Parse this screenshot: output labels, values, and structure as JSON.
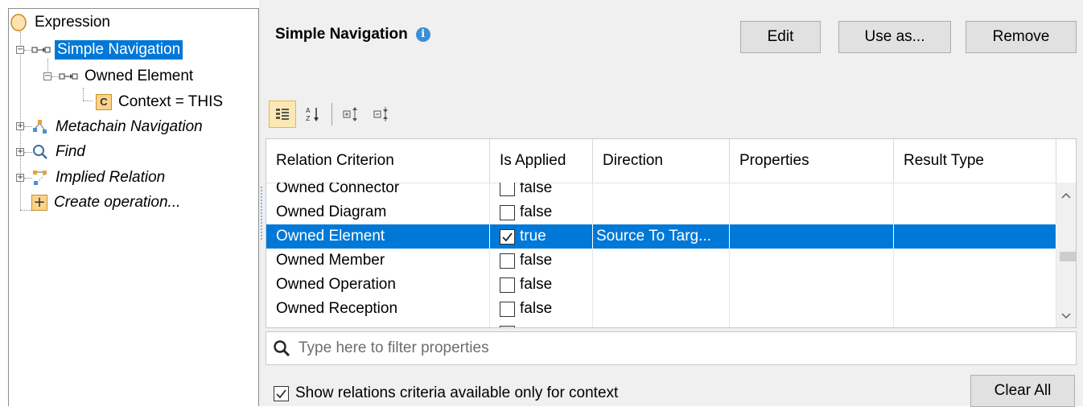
{
  "tree": {
    "items": [
      {
        "label": "Expression",
        "icon": "expression-icon"
      },
      {
        "label": "Simple Navigation",
        "icon": "navigation-icon",
        "selected": true
      },
      {
        "label": "Owned Element",
        "icon": "navigation-icon"
      },
      {
        "label": "Context = THIS",
        "icon": "context-icon",
        "icon_letter": "C"
      },
      {
        "label": "Metachain Navigation",
        "icon": "metachain-icon"
      },
      {
        "label": "Find",
        "icon": "search-icon"
      },
      {
        "label": "Implied Relation",
        "icon": "implied-relation-icon"
      },
      {
        "label": "Create operation...",
        "icon": "plus-icon"
      }
    ]
  },
  "header": {
    "title": "Simple Navigation",
    "info_icon": "info-icon",
    "buttons": {
      "edit": "Edit",
      "use_as": "Use as...",
      "remove": "Remove"
    }
  },
  "toolbar": {
    "icons": [
      "categorized-view-icon",
      "sort-alphabetically-icon",
      "expand-all-icon",
      "collapse-all-icon"
    ]
  },
  "table": {
    "columns": [
      "Relation Criterion",
      "Is Applied",
      "Direction",
      "Properties",
      "Result Type"
    ],
    "rows": [
      {
        "criterion": "Owned Connector",
        "applied": "false",
        "checked": false,
        "direction": "",
        "properties": "",
        "result_type": ""
      },
      {
        "criterion": "Owned Diagram",
        "applied": "false",
        "checked": false,
        "direction": "",
        "properties": "",
        "result_type": ""
      },
      {
        "criterion": "Owned Element",
        "applied": "true",
        "checked": true,
        "direction": "Source To Targ...",
        "properties": "",
        "result_type": "",
        "selected": true
      },
      {
        "criterion": "Owned Member",
        "applied": "false",
        "checked": false,
        "direction": "",
        "properties": "",
        "result_type": ""
      },
      {
        "criterion": "Owned Operation",
        "applied": "false",
        "checked": false,
        "direction": "",
        "properties": "",
        "result_type": ""
      },
      {
        "criterion": "Owned Reception",
        "applied": "false",
        "checked": false,
        "direction": "",
        "properties": "",
        "result_type": ""
      },
      {
        "criterion": "",
        "applied": "",
        "checked": false,
        "direction": "",
        "properties": "",
        "result_type": ""
      }
    ]
  },
  "filter": {
    "placeholder": "Type here to filter properties",
    "icon": "search-icon"
  },
  "footer": {
    "show_context_label": "Show relations criteria available only for context",
    "show_context_checked": true,
    "clear_all": "Clear All"
  },
  "colors": {
    "selection": "#0078d7",
    "panel_bg": "#f0f0f0",
    "toolbar_active": "#fce8b2"
  }
}
